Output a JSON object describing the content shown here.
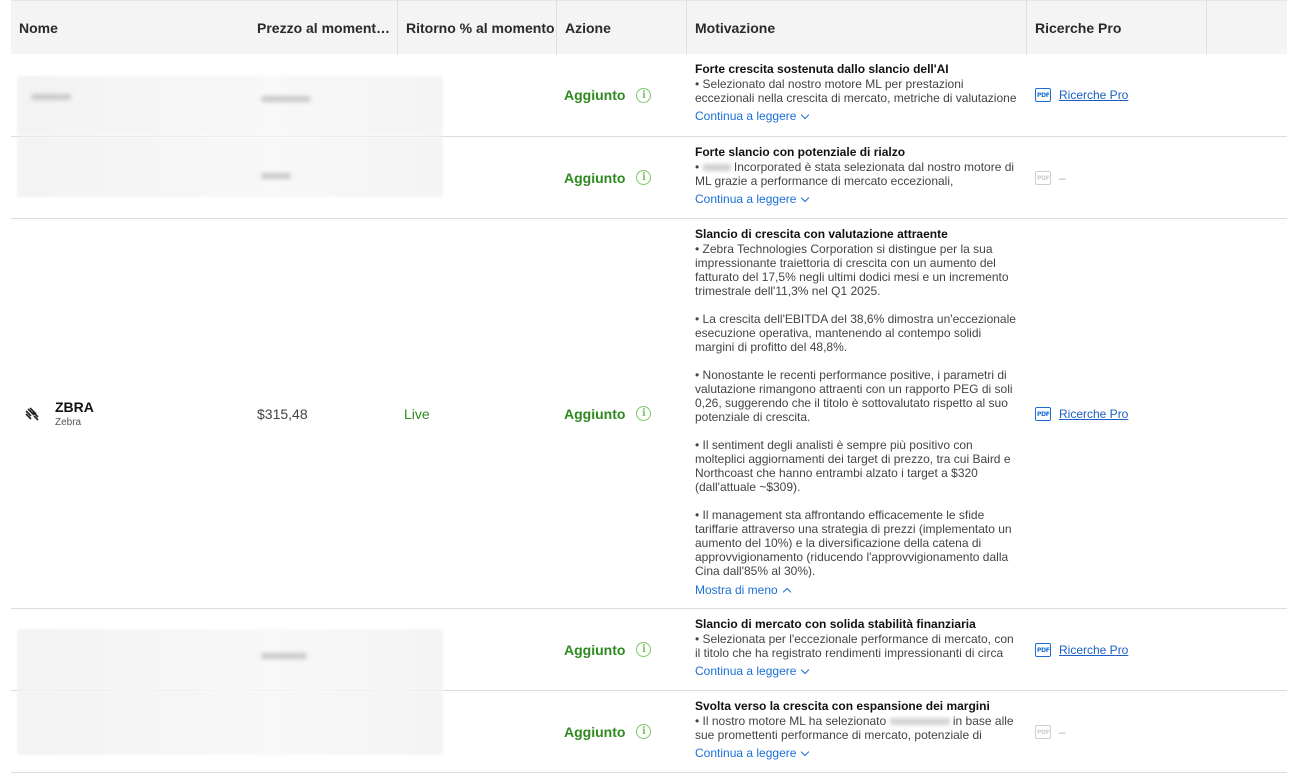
{
  "headers": {
    "name": "Nome",
    "price": "Prezzo al momento dell'aggiunta",
    "return": "Ritorno % al momento",
    "action": "Azione",
    "motivation": "Motivazione",
    "pro": "Ricerche Pro"
  },
  "rows": [
    {
      "action": "Aggiunto",
      "title": "Forte crescita sostenuta dallo slancio dell'AI",
      "body": "• Selezionato dal nostro motore ML per prestazioni eccezionali nella crescita di mercato, metriche di valutazione",
      "more": "Continua a leggere",
      "pro": "Ricerche Pro"
    },
    {
      "action": "Aggiunto",
      "title": "Forte slancio con potenziale di rialzo",
      "body_suffix": "Incorporated è stata selezionata dal nostro motore di ML grazie a performance di mercato eccezionali,",
      "more": "Continua a leggere",
      "pro_dash": "–"
    },
    {
      "ticker": "ZBRA",
      "company": "Zebra",
      "price": "$315,48",
      "return": "Live",
      "action": "Aggiunto",
      "title": "Slancio di crescita con valutazione attraente",
      "paragraphs": [
        "• Zebra Technologies Corporation si distingue per la sua impressionante traiettoria di crescita con un aumento del fatturato del 17,5% negli ultimi dodici mesi e un incremento trimestrale dell'11,3% nel Q1 2025.",
        "• La crescita dell'EBITDA del 38,6% dimostra un'eccezionale esecuzione operativa, mantenendo al contempo solidi margini di profitto del 48,8%.",
        "• Nonostante le recenti performance positive, i parametri di valutazione rimangono attraenti con un rapporto PEG di soli 0,26, suggerendo che il titolo è sottovalutato rispetto al suo potenziale di crescita.",
        "• Il sentiment degli analisti è sempre più positivo con molteplici aggiornamenti dei target di prezzo, tra cui Baird e Northcoast che hanno entrambi alzato i target a $320 (dall'attuale ~$309).",
        "• Il management sta affrontando efficacemente le sfide tariffarie attraverso una strategia di prezzi (implementato un aumento del 10%) e la diversificazione della catena di approvvigionamento (riducendo l'approvvigionamento dalla Cina dall'85% al 30%)."
      ],
      "less": "Mostra di meno",
      "pro": "Ricerche Pro"
    },
    {
      "action": "Aggiunto",
      "title": "Slancio di mercato con solida stabilità finanziaria",
      "body": "• Selezionata per l'eccezionale performance di mercato, con il titolo che ha registrato rendimenti impressionanti di circa",
      "more": "Continua a leggere",
      "pro": "Ricerche Pro"
    },
    {
      "action": "Aggiunto",
      "title": "Svolta verso la crescita con espansione dei margini",
      "body_prefix": "• Il nostro motore ML ha selezionato",
      "body_suffix": "in base alle sue promettenti performance di mercato, potenziale di",
      "more": "Continua a leggere",
      "pro_dash": "–"
    }
  ],
  "icons": {
    "info": "info-icon",
    "pdf": "pdf-icon",
    "chevron": "chevron-icon",
    "zebra_logo": "zebra-logo-icon"
  },
  "colors": {
    "action_green": "#2e8a1f",
    "link_blue": "#1a6fd6",
    "header_bg": "#f4f4f4"
  }
}
